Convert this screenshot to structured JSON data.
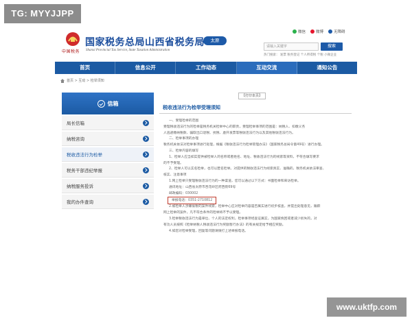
{
  "watermarks": {
    "top_left": "TG: MYYJJPP",
    "bottom_right": "www.uktfp.com"
  },
  "header": {
    "emblem_caption": "中国税务",
    "title": "国家税务总局山西省税务局",
    "subtitle": "Shanxi Provincial Tax Service, State Taxation Administration",
    "city_tag": "太原",
    "top_links": [
      {
        "label": "微信",
        "color": "#2bb24c",
        "icon": "wechat-icon"
      },
      {
        "label": "微博",
        "color": "#e6162d",
        "icon": "weibo-icon"
      },
      {
        "label": "无障碍",
        "color": "#1d5aa8",
        "icon": "accessibility-icon"
      }
    ],
    "search_placeholder": "请输入关键字",
    "search_button": "搜索",
    "hot_words": "热门搜索：  发票 税务登记 个人所得税 个税 小微企业"
  },
  "nav": {
    "items": [
      "首页",
      "信息公开",
      "工作动态",
      "互动交流",
      "通知公告"
    ],
    "active_index": 3
  },
  "breadcrumb": [
    "首页",
    "互动",
    "检举须知"
  ],
  "sidebar": {
    "header": "信箱",
    "items": [
      "局长信箱",
      "纳税咨询",
      "税收违法行为检举",
      "税务干部违纪举报",
      "纳税服务投诉",
      "我的办件查询"
    ],
    "active_index": 2
  },
  "content": {
    "print_tag": "【打印本页】",
    "title": "税收违法行为检举受理须知",
    "paragraphs": [
      {
        "text": "一、受理检举的范围",
        "indent": true
      },
      {
        "text": "受理税收违法行为的检举是税务机关检举中心的职责，受理检举事项的范围是：纳税人、扣缴义务",
        "indent": false
      },
      {
        "text": "人逃避缴纳税款、骗取出口退税、抗税、虚开发票等税收违法行为以及其他税收违法行为。",
        "indent": false
      },
      {
        "text": "二、检举事项的办理",
        "indent": true
      },
      {
        "text": "税务机关依法对检举事项进行处理，根据《税收违法行为检举管理办法》（国家税务总局令第49号）进行办理。",
        "indent": false
      },
      {
        "text": "三、检举内容的填写",
        "indent": true
      },
      {
        "text": "1、检举人应当如实提供被检举人的名称或者姓名、地址、税收违法行为的线索等资料，不符合填写要求",
        "indent": true
      },
      {
        "text": "的不予受理。",
        "indent": false
      },
      {
        "text": "2、检举人可以实名检举，也可以匿名检举。对提供的税收违法行为线索真实、准确的，税务机关依法审查、",
        "indent": true
      },
      {
        "text": "核实、注意事项",
        "indent": false
      },
      {
        "text": "1.网上检举只受理税收违法行为的一种渠道，您可以通过以下方式：书面检举和来访检举。",
        "indent": true
      },
      {
        "text": "通讯地址：山西省太原市杏花岭区府西街69号",
        "indent": true
      },
      {
        "text": "邮政编码：030002",
        "indent": true
      },
      {
        "text": "举报电话：0351-2710812",
        "indent": true,
        "highlight": true
      },
      {
        "text": "2.被检举人涉嫌偷税的案件线索，检举中心应对检举内容是否属实进行初步核查，并提出处理意见，跟踪",
        "indent": true
      },
      {
        "text": "网上检举的案件，凡不符合条件的检举将不予以受理。",
        "indent": false
      },
      {
        "text": "3.检举税收违法行为是单位、个人的法定权利，检举事项经查证属实，为国家挽回或者减少损失的，对",
        "indent": true
      },
      {
        "text": "有功人员按照《检举纳税人税收违法行为奖励暂行办法》的有关规定给予相应奖励。",
        "indent": false
      },
      {
        "text": "4.如您对检举受理，回复等问题请拨打上述举报电话。",
        "indent": true
      }
    ]
  }
}
